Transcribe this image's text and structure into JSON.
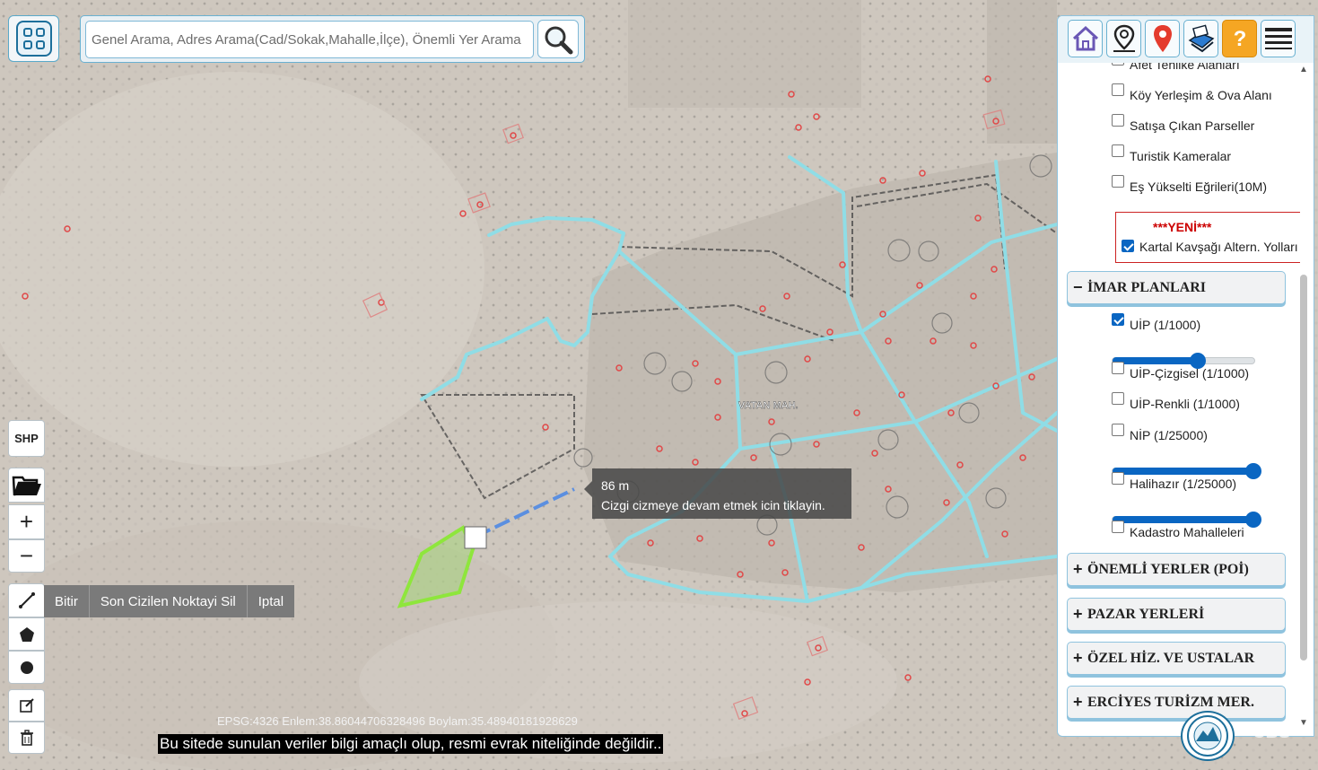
{
  "search": {
    "placeholder": "Genel Arama, Adres Arama(Cad/Sokak,Mahalle,İlçe), Önemli Yer Arama"
  },
  "toolbar": {
    "shp_label": "SHP",
    "zoom_in": "+",
    "zoom_out": "−"
  },
  "draw_actions": {
    "finish": "Bitir",
    "delete_last": "Son Cizilen Noktayi Sil",
    "cancel": "Iptal"
  },
  "tooltip": {
    "distance": "86 m",
    "hint": "Cizgi cizmeye devam etmek icin tiklayin."
  },
  "map": {
    "neighborhood_label": "VATAN MAH.",
    "coords": "EPSG:4326 Enlem:38.86044706328496 Boylam:35.48940181928629",
    "disclaimer": "Bu sitede sunulan veriler bilgi amaçlı olup, resmi evrak niteliğinde değildir..",
    "watermark": "CBS"
  },
  "panel": {
    "top_icons": [
      "home-icon",
      "map-pin-outline-icon",
      "location-marker-icon",
      "print-map-icon",
      "help-icon",
      "menu-icon"
    ],
    "layers_top": [
      {
        "label": "Afet Tehlike Alanları",
        "checked": false
      },
      {
        "label": "Köy Yerleşim & Ova Alanı",
        "checked": false
      },
      {
        "label": "Satışa Çıkan Parseller",
        "checked": false
      },
      {
        "label": "Turistik Kameralar",
        "checked": false
      },
      {
        "label": "Eş Yükselti Eğrileri(10M)",
        "checked": false
      }
    ],
    "new_box": {
      "title": "***YENİ***",
      "label": "Kartal Kavşağı Altern. Yolları",
      "checked": true
    },
    "sections": {
      "imar": {
        "sign": "−",
        "label": "İMAR PLANLARI"
      },
      "poi": {
        "sign": "+",
        "label": "ÖNEMLİ YERLER (POİ)"
      },
      "pazar": {
        "sign": "+",
        "label": "PAZAR YERLERİ"
      },
      "ozel": {
        "sign": "+",
        "label": "ÖZEL HİZ. VE USTALAR"
      },
      "erciyes": {
        "sign": "+",
        "label": "ERCİYES TURİZM MER."
      }
    },
    "imar_layers": [
      {
        "label": "UİP (1/1000)",
        "checked": true,
        "opacity": 0.6
      },
      {
        "label": "UİP-Çizgisel (1/1000)",
        "checked": false
      },
      {
        "label": "UİP-Renkli (1/1000)",
        "checked": false
      },
      {
        "label": "NİP (1/25000)",
        "checked": false,
        "opacity": 1.0
      },
      {
        "label": "Halihazır (1/25000)",
        "checked": false,
        "opacity": 1.0
      },
      {
        "label": "Kadastro Mahalleleri",
        "checked": false
      }
    ]
  },
  "colors": {
    "accent": "#0a66c2",
    "road_line": "#8fdde6",
    "drawn_polygon": "#8ee63c",
    "measure_line": "#5b8fe0",
    "building_marker": "#e04848",
    "new_title": "#cc0000"
  }
}
